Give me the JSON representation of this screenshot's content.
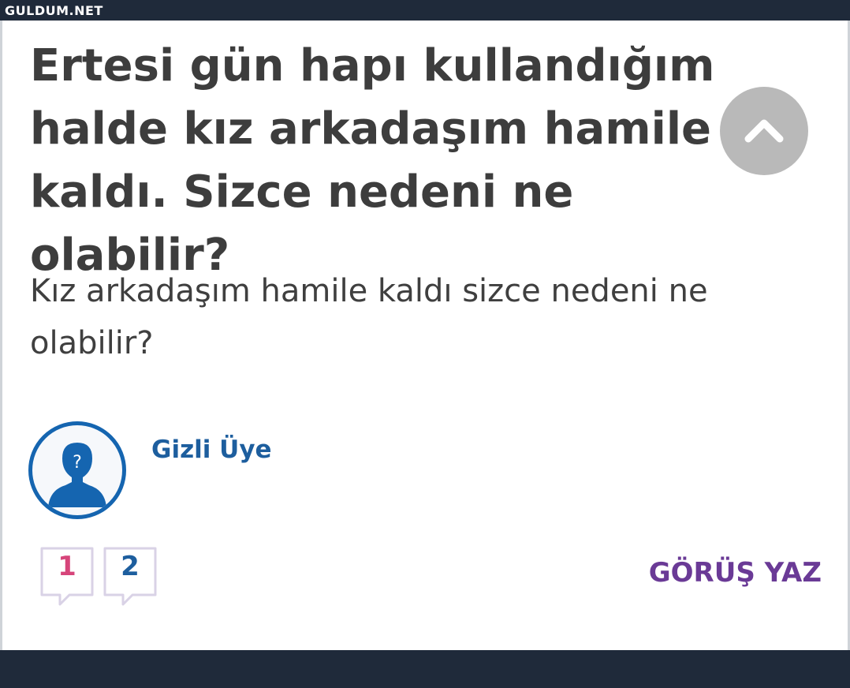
{
  "watermark": "GULDUM.NET",
  "question": {
    "title": "Ertesi gün hapı kullandığım halde kız arkadaşım hamile kaldı. Sizce nedeni ne olabilir?",
    "body": "Kız arkadaşım hamile kaldı sizce nedeni ne olabilir?"
  },
  "author": {
    "name": "Gizli Üye",
    "avatar_icon": "anonymous-user-icon"
  },
  "counters": [
    {
      "value": "1",
      "color": "#d6457a"
    },
    {
      "value": "2",
      "color": "#1d5e9e"
    }
  ],
  "actions": {
    "write_opinion": "GÖRÜŞ YAZ"
  },
  "colors": {
    "title": "#3d3d3d",
    "author": "#1d5e9e",
    "action": "#6a3a96",
    "frame": "#1f2a3a"
  }
}
